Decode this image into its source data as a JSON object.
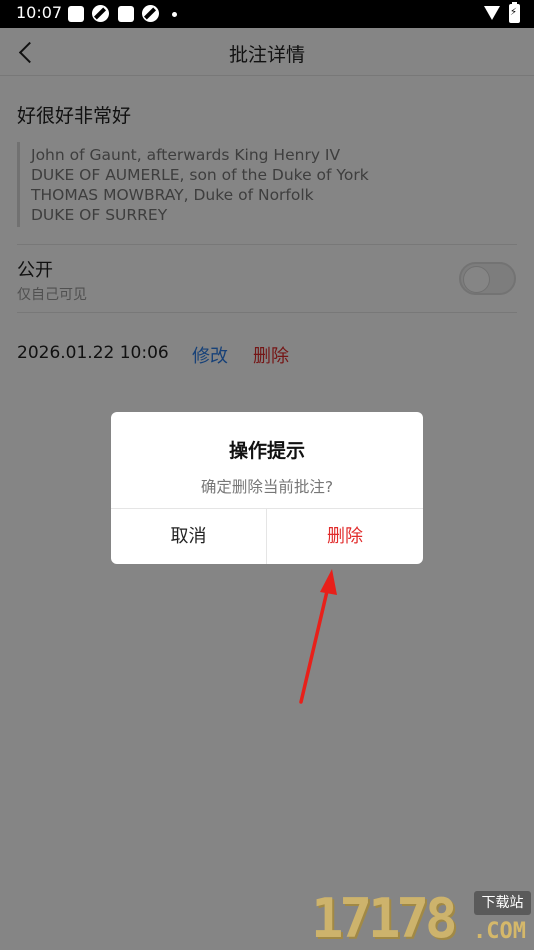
{
  "status_bar": {
    "time": "10:07"
  },
  "header": {
    "title": "批注详情"
  },
  "annotation": {
    "note": "好很好非常好",
    "quote_lines": [
      "John of Gaunt, afterwards King Henry IV",
      "DUKE OF AUMERLE, son of the Duke of York",
      "THOMAS MOWBRAY, Duke of Norfolk",
      "DUKE OF SURREY"
    ]
  },
  "visibility": {
    "label": "公开",
    "sublabel": "仅自己可见",
    "public": false
  },
  "meta": {
    "timestamp": "2026.01.22 10:06",
    "edit_label": "修改",
    "delete_label": "删除"
  },
  "dialog": {
    "title": "操作提示",
    "message": "确定删除当前批注?",
    "cancel_label": "取消",
    "confirm_label": "删除"
  },
  "watermark": {
    "number": "17178",
    "tag": "下载站",
    "domain": ".COM"
  },
  "colors": {
    "accent_blue": "#2d7ee6",
    "danger_red": "#e12b2b",
    "arrow_red": "#e8201a"
  }
}
